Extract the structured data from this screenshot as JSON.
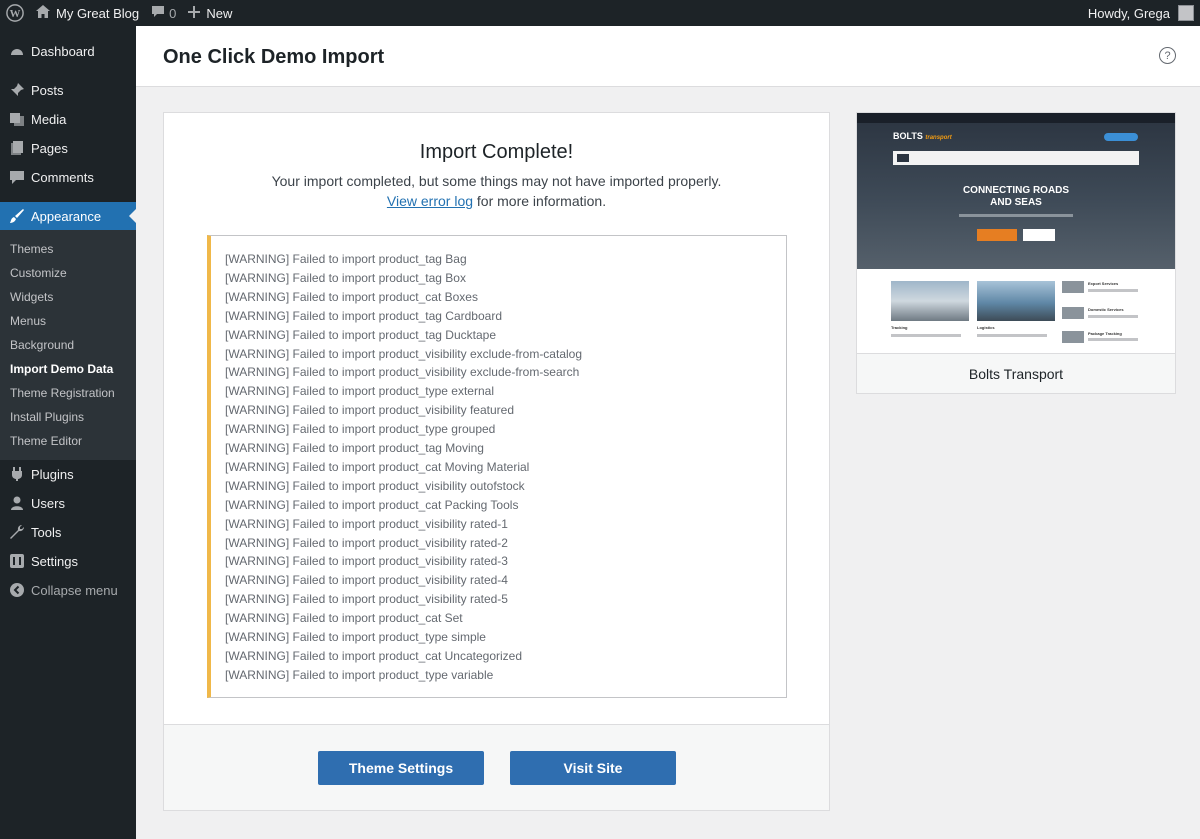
{
  "adminbar": {
    "site_name": "My Great Blog",
    "comments_count": "0",
    "new_label": "New",
    "greeting": "Howdy, Grega"
  },
  "sidebar": {
    "items": [
      {
        "label": "Dashboard",
        "icon": "dashboard-icon"
      },
      {
        "label": "Posts",
        "icon": "pin-icon"
      },
      {
        "label": "Media",
        "icon": "media-icon"
      },
      {
        "label": "Pages",
        "icon": "pages-icon"
      },
      {
        "label": "Comments",
        "icon": "comment-icon"
      },
      {
        "label": "Appearance",
        "icon": "brush-icon"
      }
    ],
    "submenu": [
      "Themes",
      "Customize",
      "Widgets",
      "Menus",
      "Background",
      "Import Demo Data",
      "Theme Registration",
      "Install Plugins",
      "Theme Editor"
    ],
    "items_after": [
      {
        "label": "Plugins",
        "icon": "plugin-icon"
      },
      {
        "label": "Users",
        "icon": "user-icon"
      },
      {
        "label": "Tools",
        "icon": "wrench-icon"
      },
      {
        "label": "Settings",
        "icon": "settings-icon"
      }
    ],
    "collapse_label": "Collapse menu"
  },
  "header": {
    "title": "One Click Demo Import",
    "help_icon": "?"
  },
  "import": {
    "title": "Import Complete!",
    "message": "Your import completed, but some things may not have imported properly.",
    "link_text": "View error log",
    "after_link": " for more information.",
    "log": [
      "[WARNING] Failed to import product_tag Bag",
      "[WARNING] Failed to import product_tag Box",
      "[WARNING] Failed to import product_cat Boxes",
      "[WARNING] Failed to import product_tag Cardboard",
      "[WARNING] Failed to import product_tag Ducktape",
      "[WARNING] Failed to import product_visibility exclude-from-catalog",
      "[WARNING] Failed to import product_visibility exclude-from-search",
      "[WARNING] Failed to import product_type external",
      "[WARNING] Failed to import product_visibility featured",
      "[WARNING] Failed to import product_type grouped",
      "[WARNING] Failed to import product_tag Moving",
      "[WARNING] Failed to import product_cat Moving Material",
      "[WARNING] Failed to import product_visibility outofstock",
      "[WARNING] Failed to import product_cat Packing Tools",
      "[WARNING] Failed to import product_visibility rated-1",
      "[WARNING] Failed to import product_visibility rated-2",
      "[WARNING] Failed to import product_visibility rated-3",
      "[WARNING] Failed to import product_visibility rated-4",
      "[WARNING] Failed to import product_visibility rated-5",
      "[WARNING] Failed to import product_cat Set",
      "[WARNING] Failed to import product_type simple",
      "[WARNING] Failed to import product_cat Uncategorized",
      "[WARNING] Failed to import product_type variable"
    ],
    "buttons": {
      "theme_settings": "Theme Settings",
      "visit_site": "Visit Site"
    }
  },
  "theme": {
    "name": "Bolts Transport",
    "preview": {
      "logo_main": "BOLTS",
      "logo_accent": "transport",
      "headline_line1": "CONNECTING ROADS",
      "headline_line2": "AND SEAS",
      "services": [
        "Export Services",
        "Domestic Services",
        "Package Tracking"
      ],
      "captions": [
        "Tracking",
        "Logistics"
      ]
    }
  },
  "colors": {
    "accent": "#2271b1",
    "button": "#2f6eb0",
    "warning_border": "#f0b849",
    "sidebar_bg": "#1d2327"
  }
}
